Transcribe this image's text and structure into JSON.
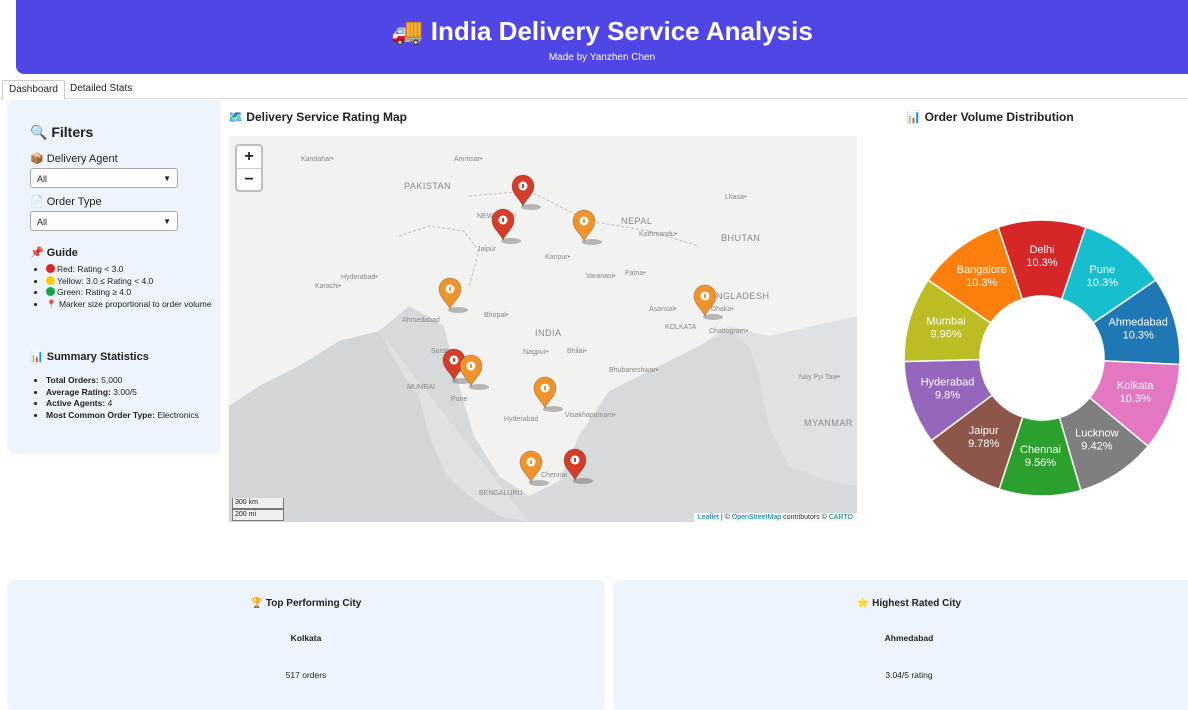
{
  "header": {
    "title": "🚚 India Delivery Service Analysis",
    "subtitle": "Made by Yanzhen Chen"
  },
  "tabs": [
    {
      "label": "Dashboard",
      "active": true
    },
    {
      "label": "Detailed Stats",
      "active": false
    }
  ],
  "filters": {
    "heading": "🔍 Filters",
    "agent_label": "📦 Delivery Agent",
    "agent_value": "All",
    "order_type_label": "📄 Order Type",
    "order_type_value": "All"
  },
  "guide": {
    "heading": "📌 Guide",
    "items": [
      {
        "color": "#dc2626",
        "text": "Red: Rating < 3.0"
      },
      {
        "color": "#facc15",
        "text": "Yellow: 3.0 ≤ Rating < 4.0"
      },
      {
        "color": "#16a34a",
        "text": "Green: Rating ≥ 4.0"
      },
      {
        "icon": "📍",
        "text": "Marker size proportional to order volume"
      }
    ]
  },
  "summary": {
    "heading": "📊 Summary Statistics",
    "items": [
      {
        "label": "Total Orders:",
        "value": "5,000"
      },
      {
        "label": "Average Rating:",
        "value": "3.00/5"
      },
      {
        "label": "Active Agents:",
        "value": "4"
      },
      {
        "label": "Most Common Order Type:",
        "value": "Electronics"
      }
    ]
  },
  "map": {
    "title": "🗺️ Delivery Service Rating Map",
    "zoom_in": "+",
    "zoom_out": "−",
    "scale_km": "300 km",
    "scale_mi": "200 mi",
    "attribution": {
      "leaflet": "Leaflet",
      "sep1": " | © ",
      "osm": "OpenStreetMap",
      "mid": " contributors © ",
      "carto": "CARTO"
    },
    "labels": [
      "Kandahar•",
      "Amritsar•",
      "PAKISTAN",
      "NEW DELHI",
      "Jaipur",
      "Kanpur•",
      "NEPAL",
      "Kathmandu•",
      "BHUTAN",
      "Lhasa•",
      "Hyderabad•",
      "Karachi•",
      "Varanasi•",
      "Patna•",
      "BANGLADESH",
      "Asansol•",
      "Dhaka•",
      "Ahmedabad",
      "Bhopal•",
      "INDIA",
      "KOLKATA",
      "Chattogram•",
      "Surat•",
      "Nagpur•",
      "Bhilai•",
      "MUMBAI",
      "Pune",
      "Bhubaneshwar•",
      "Nay Pyi Taw•",
      "Hyderabad",
      "Visakhapatnam•",
      "MYANMAR",
      "BENGALURU",
      "Chennai"
    ],
    "markers": [
      {
        "city": "Delhi",
        "color": "red"
      },
      {
        "city": "Jaipur",
        "color": "red"
      },
      {
        "city": "Lucknow",
        "color": "orange"
      },
      {
        "city": "Ahmedabad",
        "color": "orange"
      },
      {
        "city": "Kolkata",
        "color": "orange"
      },
      {
        "city": "Mumbai",
        "color": "red"
      },
      {
        "city": "Pune",
        "color": "orange"
      },
      {
        "city": "Hyderabad",
        "color": "orange"
      },
      {
        "city": "Bangalore",
        "color": "orange"
      },
      {
        "city": "Chennai",
        "color": "red"
      }
    ]
  },
  "pie": {
    "title": "📊 Order Volume Distribution"
  },
  "chart_data": {
    "type": "pie",
    "donut": true,
    "slices": [
      {
        "label": "Delhi",
        "pct": 10.3,
        "text": "10.3%",
        "color": "#d62728"
      },
      {
        "label": "Pune",
        "pct": 10.3,
        "text": "10.3%",
        "color": "#17becf"
      },
      {
        "label": "Ahmedabad",
        "pct": 10.3,
        "text": "10.3%",
        "color": "#1f77b4"
      },
      {
        "label": "Kolkata",
        "pct": 10.3,
        "text": "10.3%",
        "color": "#e377c2"
      },
      {
        "label": "Lucknow",
        "pct": 9.42,
        "text": "9.42%",
        "color": "#7f7f7f"
      },
      {
        "label": "Chennai",
        "pct": 9.56,
        "text": "9.56%",
        "color": "#2ca02c"
      },
      {
        "label": "Jaipur",
        "pct": 9.78,
        "text": "9.78%",
        "color": "#8c564b"
      },
      {
        "label": "Hyderabad",
        "pct": 9.8,
        "text": "9.8%",
        "color": "#9467bd"
      },
      {
        "label": "Mumbai",
        "pct": 9.96,
        "text": "9.96%",
        "color": "#bcbd22"
      },
      {
        "label": "Bangalore",
        "pct": 10.3,
        "text": "10.3%",
        "color": "#ff7f0e"
      }
    ]
  },
  "cards": [
    {
      "title": "🏆 Top Performing City",
      "value": "Kolkata",
      "sub": "517 orders"
    },
    {
      "title": "⭐ Highest Rated City",
      "value": "Ahmedabad",
      "sub": "3.04/5 rating"
    }
  ]
}
